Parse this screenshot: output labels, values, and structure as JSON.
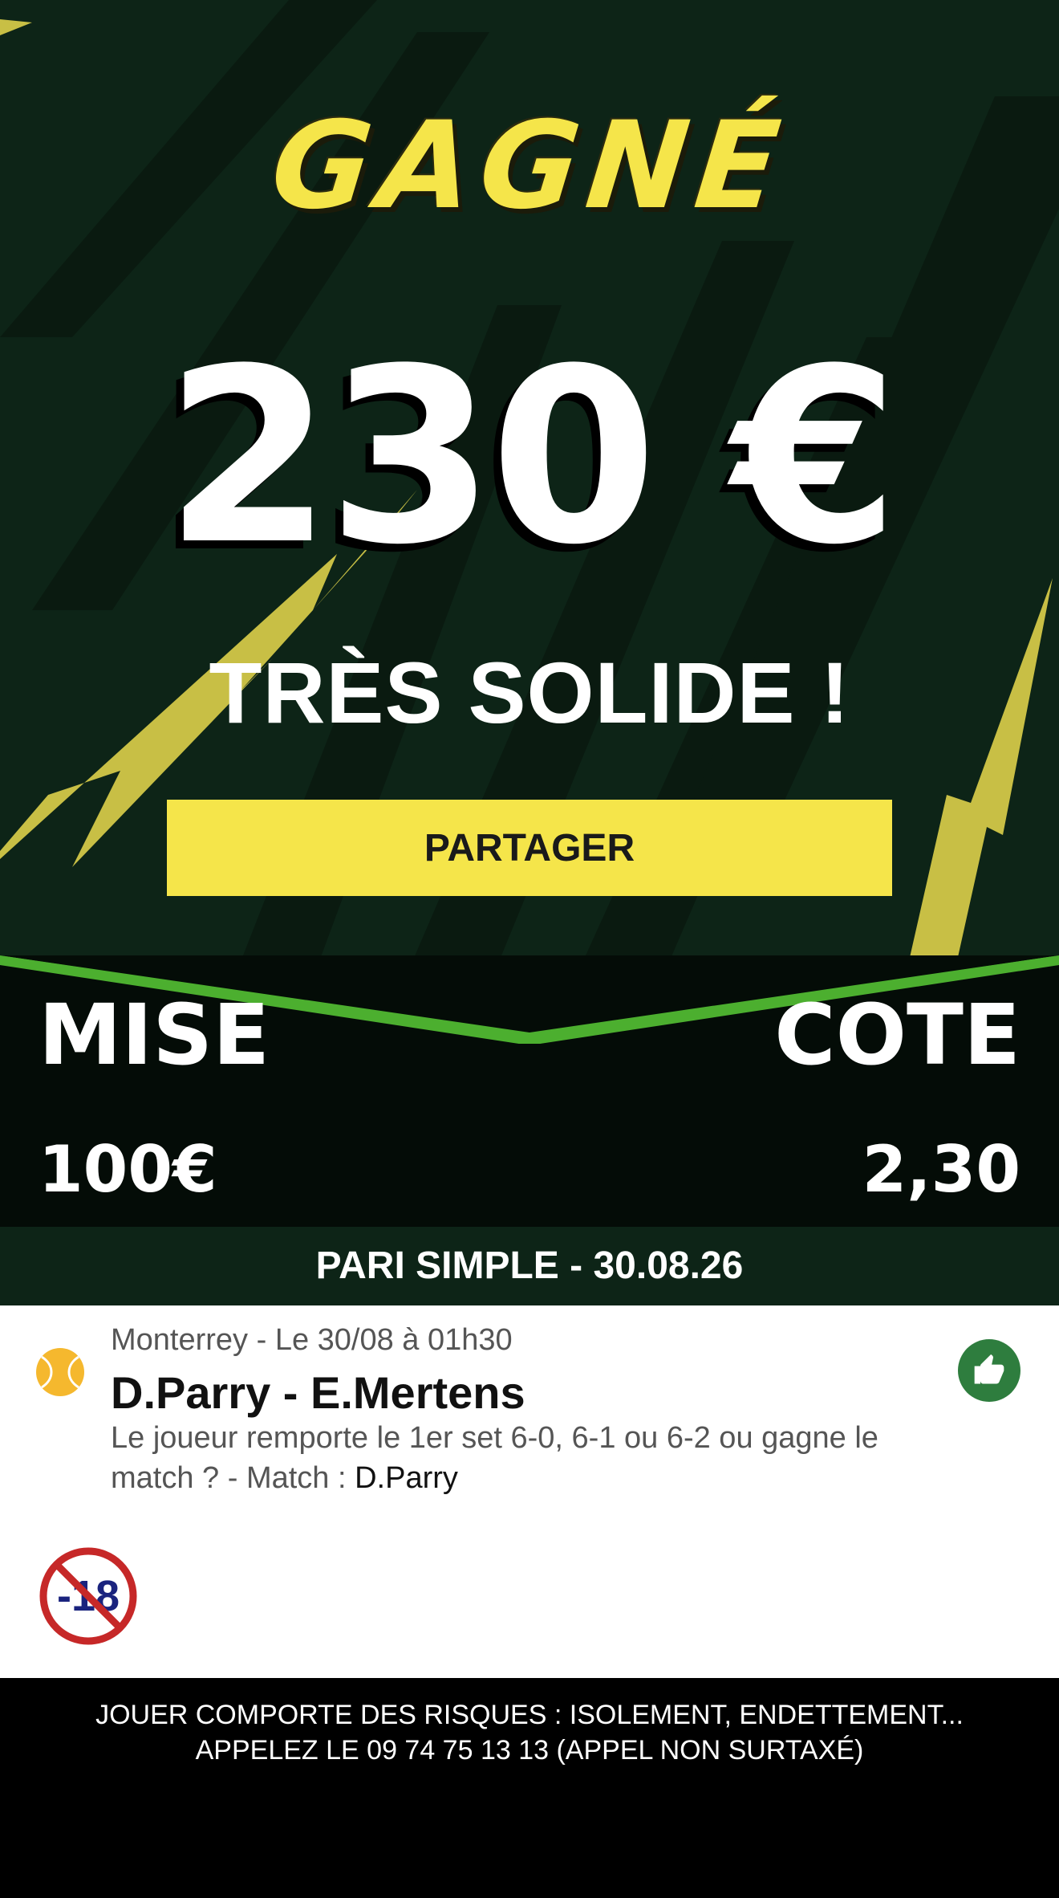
{
  "hero": {
    "title": "GAGNÉ",
    "amount": "230 €",
    "subtitle": "TRÈS SOLIDE !",
    "share_label": "PARTAGER"
  },
  "stake": {
    "mise_label": "MISE",
    "cote_label": "COTE",
    "mise_value": "100€",
    "cote_value": "2,30"
  },
  "bet_type": "PARI SIMPLE - 30.08.26",
  "bet": {
    "sport_icon": "tennis-ball-icon",
    "meta": "Monterrey - Le 30/08 à 01h30",
    "match": "D.Parry - E.Mertens",
    "question": "Le joueur remporte le 1er set 6-0, 6-1 ou 6-2 ou gagne le match ? - Match : ",
    "selection": "D.Parry",
    "status_icon": "thumbs-up-icon"
  },
  "age_limit": {
    "icon": "no-under-18-icon",
    "text": "-18"
  },
  "footer": {
    "line1": "JOUER COMPORTE DES RISQUES : ISOLEMENT, ENDETTEMENT...",
    "line2": "APPELEZ LE 09 74 75 13 13 (APPEL NON SURTAXÉ)"
  },
  "colors": {
    "accent_yellow": "#f5e54a",
    "dark_green": "#0d2417",
    "green_stripe": "#4caf2f",
    "thumb_green": "#2e7d3e"
  }
}
